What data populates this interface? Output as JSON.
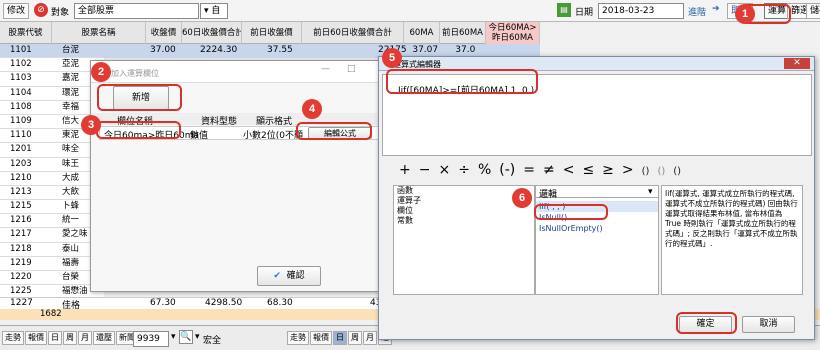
{
  "toolbar": {
    "modify": "修改",
    "target_label": "對象",
    "target_value": "全部股票",
    "date_label": "日期",
    "date_value": "2018-03-23",
    "advance": "進階",
    "realtime": "即時",
    "calc": "運算",
    "filter": "篩選",
    "store": "儲存"
  },
  "grid": {
    "headers": [
      "股票代號",
      "股票名稱",
      "收盤價",
      "60日收盤價合計",
      "前日收盤價",
      "前日60日收盤價合計",
      "60MA",
      "前日60MA",
      "今日60MA>\n昨日60MA"
    ],
    "first_row": {
      "price": "37.00",
      "sum60": "2224.30",
      "prev_price": "37.55",
      "trunc": "22175  37.07      37.0"
    },
    "rows": [
      [
        "1101",
        "台泥"
      ],
      [
        "1102",
        "亞泥"
      ],
      [
        "1103",
        "嘉泥"
      ],
      [
        "1104",
        "環泥"
      ],
      [
        "1108",
        "幸福"
      ],
      [
        "1109",
        "信大"
      ],
      [
        "1110",
        "東泥"
      ],
      [
        "1201",
        "味全"
      ],
      [
        "1203",
        "味王"
      ],
      [
        "1210",
        "大成"
      ],
      [
        "1213",
        "大飲"
      ],
      [
        "1215",
        "卜蜂"
      ],
      [
        "1216",
        "統一"
      ],
      [
        "1217",
        "愛之味"
      ],
      [
        "1218",
        "泰山"
      ],
      [
        "1219",
        "福壽"
      ],
      [
        "1220",
        "台榮"
      ],
      [
        "1225",
        "福懋油"
      ]
    ],
    "last_row": {
      "code": "1227",
      "name": "佳格",
      "price": "67.30",
      "sum60": "4298.50",
      "prev_price": "68.30",
      "trunc": "43"
    },
    "count": "1682"
  },
  "add_dialog": {
    "title": "加入運算欄位",
    "add_button": "新增",
    "col_headers": [
      "欄位名稱",
      "資料型態",
      "顯示格式"
    ],
    "field_name": "今日60ma>昨日60ma",
    "field_type": "數值",
    "field_format": "小數2位(0不顯示)",
    "edit_formula": "編輯公式",
    "confirm": "確認"
  },
  "formula_dialog": {
    "title": "運算式編輯器",
    "formula": "Iif([60MA]>=[前日60MA],1 ,0 )",
    "operators": [
      "+",
      "−",
      "×",
      "÷",
      "%",
      "(-)",
      "=",
      "≠",
      "<",
      "≤",
      "≥",
      ">",
      "()",
      "()",
      "()"
    ],
    "categories": [
      "函數",
      "運算子",
      "欄位",
      "常數"
    ],
    "func_select": "邏輯",
    "functions": [
      "Iif( , , )",
      "IsNull()",
      "IsNullOrEmpty()"
    ],
    "description": "Iif(運算式, 運算式成立所執行的程式碼, 運算式不成立所執行的程式碼) 回由執行運算式取得結果布林值, 當布林值為 True 時則執行「運算式成立所執行的程式碼」; 反之則執行「運算式不成立所執行的程式碼」.",
    "ok": "確定",
    "cancel": "取消"
  },
  "bottom": {
    "left_tabs": [
      "走勢",
      "報價",
      "日",
      "周",
      "月",
      "還壓",
      "新聞",
      "籌記"
    ],
    "stock_code": "9939",
    "stock_name": "宏全",
    "right_tabs": [
      "走勢",
      "報價",
      "日",
      "周",
      "月",
      "還"
    ]
  },
  "steps": [
    "1",
    "2",
    "3",
    "4",
    "5",
    "6"
  ]
}
